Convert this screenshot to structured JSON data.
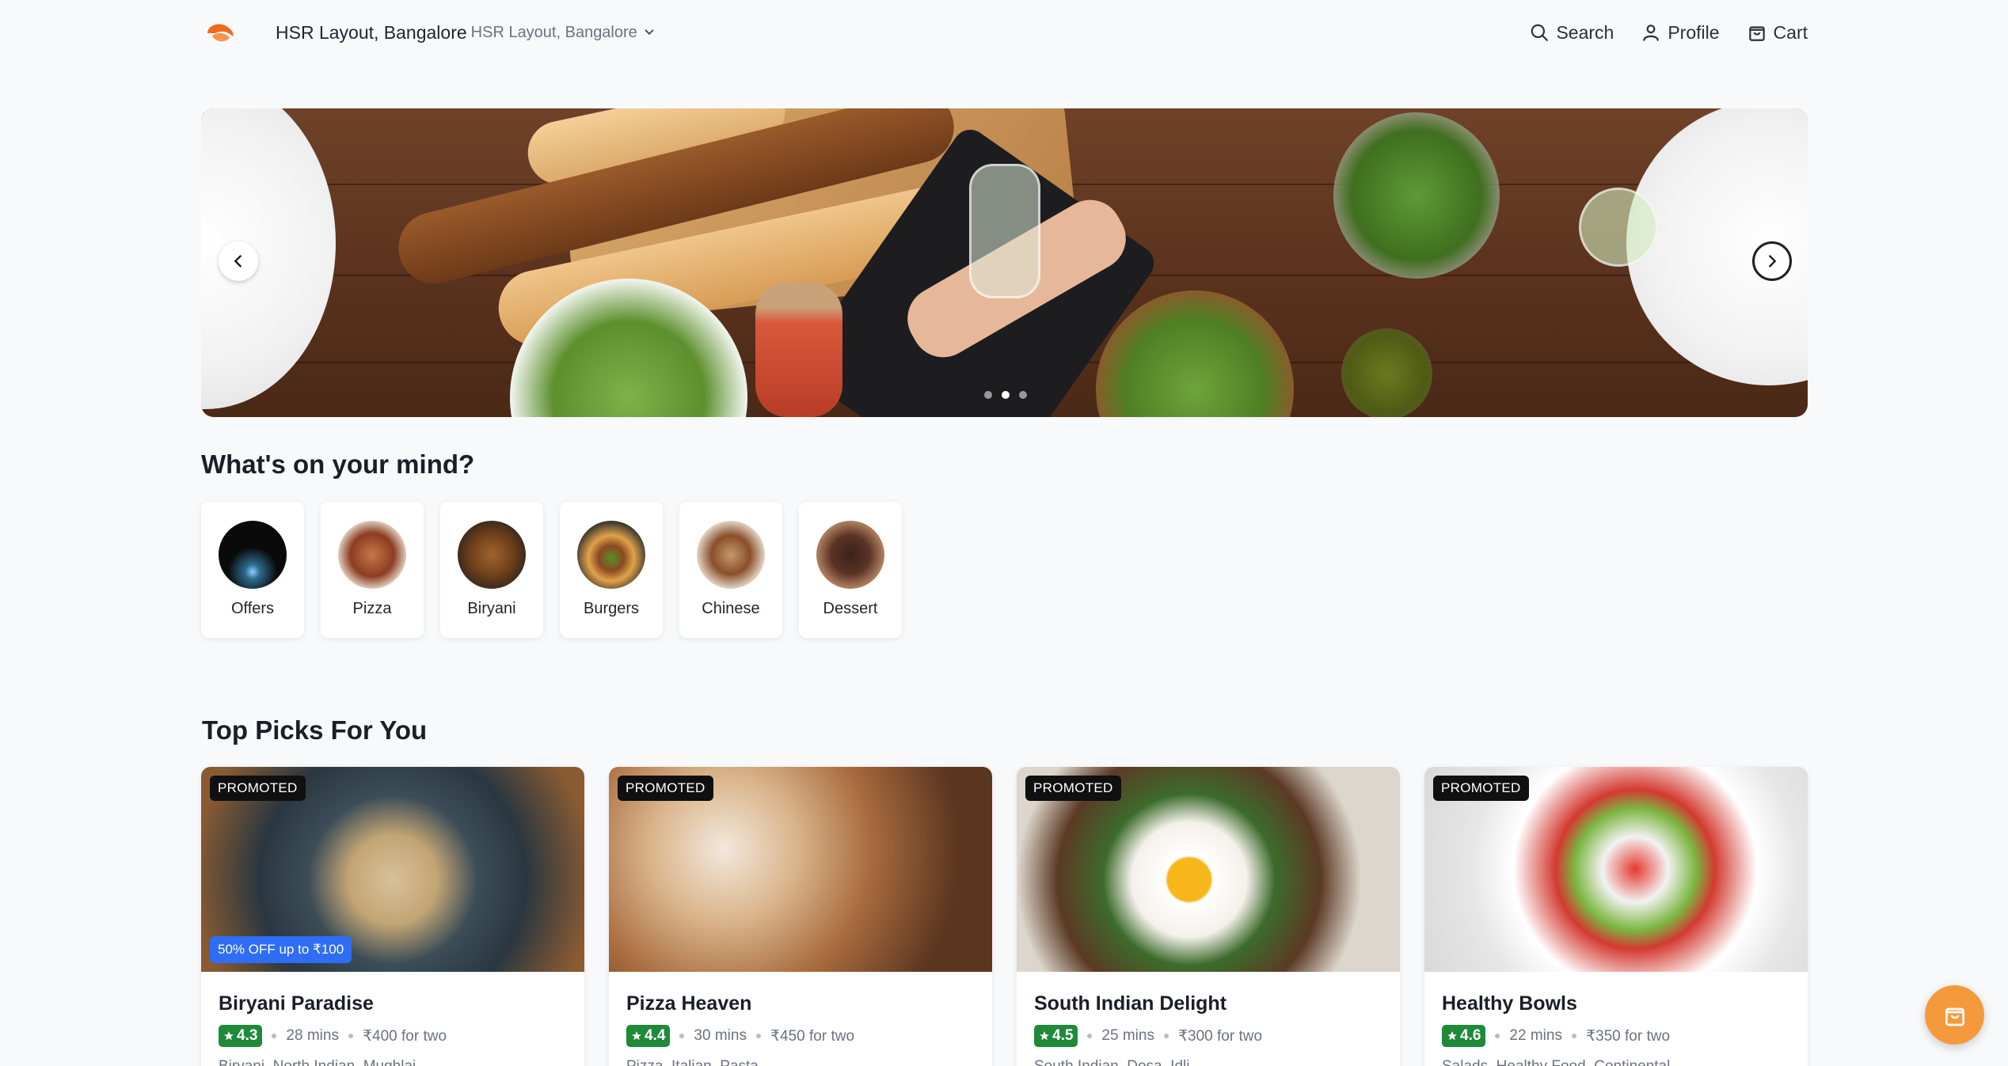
{
  "header": {
    "location_main": "HSR Layout, Bangalore",
    "location_sub": "HSR Layout, Bangalore",
    "nav": {
      "search": "Search",
      "profile": "Profile",
      "cart": "Cart"
    },
    "brand_color": "#f26a1b"
  },
  "banner": {
    "slide_count": 3,
    "active_slide": 2
  },
  "categories": {
    "title": "What's on your mind?",
    "items": [
      {
        "label": "Offers"
      },
      {
        "label": "Pizza"
      },
      {
        "label": "Biryani"
      },
      {
        "label": "Burgers"
      },
      {
        "label": "Chinese"
      },
      {
        "label": "Dessert"
      }
    ]
  },
  "top_picks": {
    "title": "Top Picks For You",
    "cards": [
      {
        "badge": "PROMOTED",
        "offer": "50% OFF up to ₹100",
        "name": "Biryani Paradise",
        "rating": "4.3",
        "time": "28 mins",
        "price": "₹400 for two",
        "cuisines": "Biryani, North Indian, Mughlai"
      },
      {
        "badge": "PROMOTED",
        "offer": "",
        "name": "Pizza Heaven",
        "rating": "4.4",
        "time": "30 mins",
        "price": "₹450 for two",
        "cuisines": "Pizza, Italian, Pasta"
      },
      {
        "badge": "PROMOTED",
        "offer": "",
        "name": "South Indian Delight",
        "rating": "4.5",
        "time": "25 mins",
        "price": "₹300 for two",
        "cuisines": "South Indian, Dosa, Idli"
      },
      {
        "badge": "PROMOTED",
        "offer": "",
        "name": "Healthy Bowls",
        "rating": "4.6",
        "time": "22 mins",
        "price": "₹350 for two",
        "cuisines": "Salads, Healthy Food, Continental"
      }
    ]
  },
  "colors": {
    "rating_green": "#1f8a3a",
    "offer_blue": "#2f6df6",
    "fab_orange": "#f59a3c"
  },
  "icons": {
    "logo": "logo-icon",
    "search": "search-icon",
    "profile": "user-icon",
    "cart": "shopping-bag-icon",
    "fab": "shopping-bag-icon"
  }
}
